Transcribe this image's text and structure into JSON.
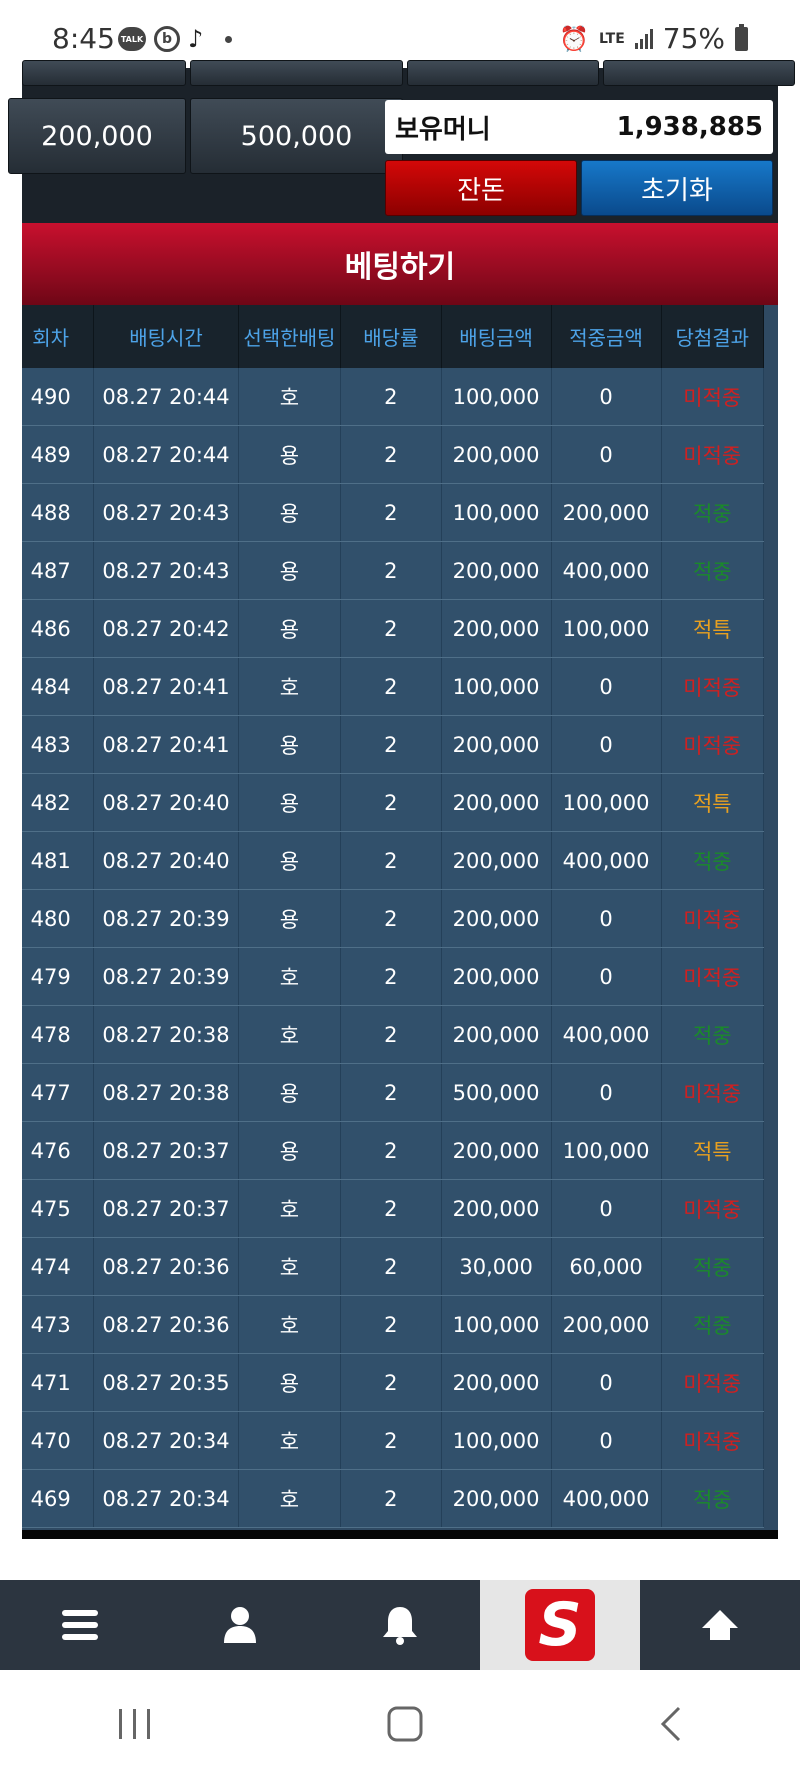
{
  "status": {
    "time": "8:45",
    "talk_label": "TALK",
    "b_label": "b",
    "network": "LTE",
    "battery": "75%"
  },
  "chips": {
    "row1": [
      "",
      "",
      "",
      ""
    ],
    "row2": [
      "200,000",
      "500,000"
    ]
  },
  "wallet": {
    "label": "보유머니",
    "value": "1,938,885"
  },
  "buttons": {
    "change": "잔돈",
    "reset": "초기화"
  },
  "banner": "베팅하기",
  "table": {
    "headers": [
      "회차",
      "배팅시간",
      "선택한배팅",
      "배당률",
      "배팅금액",
      "적중금액",
      "당첨결과"
    ],
    "rows": [
      [
        "490",
        "08.27 20:44",
        "호",
        "2",
        "100,000",
        "0",
        "미적중"
      ],
      [
        "489",
        "08.27 20:44",
        "용",
        "2",
        "200,000",
        "0",
        "미적중"
      ],
      [
        "488",
        "08.27 20:43",
        "용",
        "2",
        "100,000",
        "200,000",
        "적중"
      ],
      [
        "487",
        "08.27 20:43",
        "용",
        "2",
        "200,000",
        "400,000",
        "적중"
      ],
      [
        "486",
        "08.27 20:42",
        "용",
        "2",
        "200,000",
        "100,000",
        "적특"
      ],
      [
        "484",
        "08.27 20:41",
        "호",
        "2",
        "100,000",
        "0",
        "미적중"
      ],
      [
        "483",
        "08.27 20:41",
        "용",
        "2",
        "200,000",
        "0",
        "미적중"
      ],
      [
        "482",
        "08.27 20:40",
        "용",
        "2",
        "200,000",
        "100,000",
        "적특"
      ],
      [
        "481",
        "08.27 20:40",
        "용",
        "2",
        "200,000",
        "400,000",
        "적중"
      ],
      [
        "480",
        "08.27 20:39",
        "용",
        "2",
        "200,000",
        "0",
        "미적중"
      ],
      [
        "479",
        "08.27 20:39",
        "호",
        "2",
        "200,000",
        "0",
        "미적중"
      ],
      [
        "478",
        "08.27 20:38",
        "호",
        "2",
        "200,000",
        "400,000",
        "적중"
      ],
      [
        "477",
        "08.27 20:38",
        "용",
        "2",
        "500,000",
        "0",
        "미적중"
      ],
      [
        "476",
        "08.27 20:37",
        "용",
        "2",
        "200,000",
        "100,000",
        "적특"
      ],
      [
        "475",
        "08.27 20:37",
        "호",
        "2",
        "200,000",
        "0",
        "미적중"
      ],
      [
        "474",
        "08.27 20:36",
        "호",
        "2",
        "30,000",
        "60,000",
        "적중"
      ],
      [
        "473",
        "08.27 20:36",
        "호",
        "2",
        "100,000",
        "200,000",
        "적중"
      ],
      [
        "471",
        "08.27 20:35",
        "용",
        "2",
        "200,000",
        "0",
        "미적중"
      ],
      [
        "470",
        "08.27 20:34",
        "호",
        "2",
        "100,000",
        "0",
        "미적중"
      ],
      [
        "469",
        "08.27 20:34",
        "호",
        "2",
        "200,000",
        "400,000",
        "적중"
      ]
    ]
  },
  "nav": {
    "items": [
      "menu-icon",
      "user-icon",
      "bell-icon",
      "logo",
      "arrow-up-icon"
    ],
    "logo_letter": "S"
  },
  "colors": {
    "miss": "#d02020",
    "hit": "#1a8a2a",
    "special": "#e8a020",
    "header_text": "#4da3e8",
    "banner": "#b00d26"
  }
}
